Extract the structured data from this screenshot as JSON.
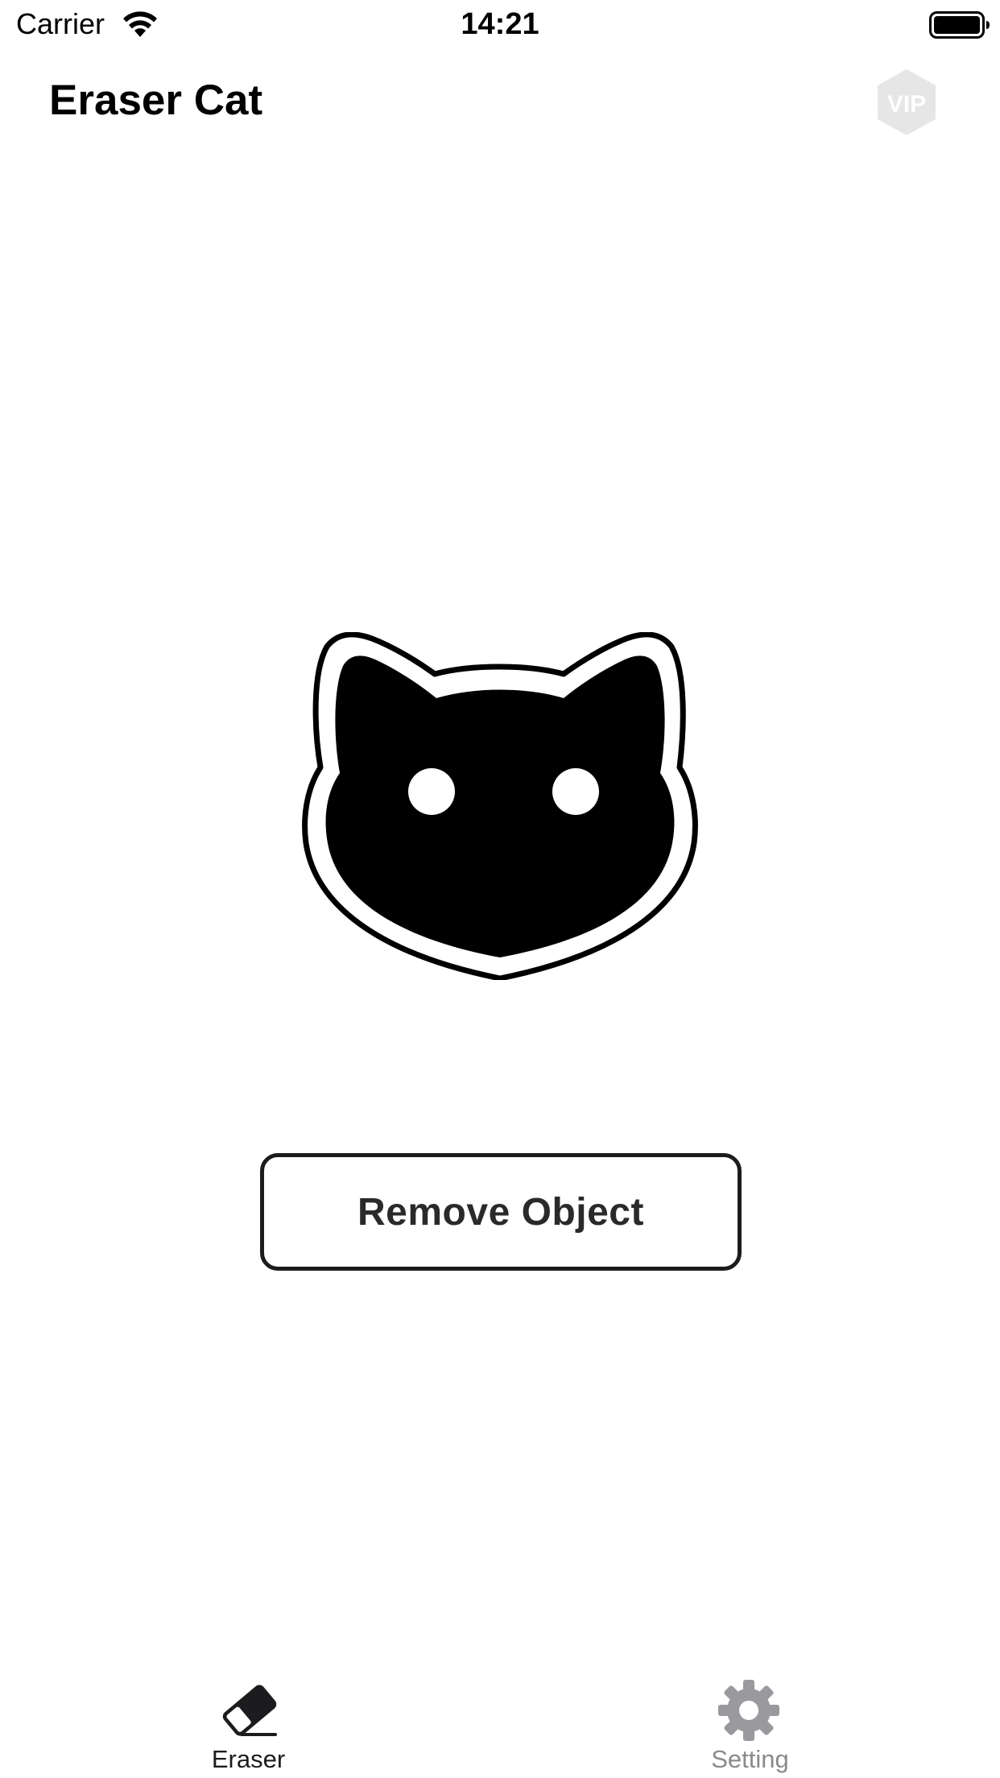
{
  "status_bar": {
    "carrier": "Carrier",
    "time": "14:21",
    "wifi_icon": "wifi-icon",
    "battery_icon": "battery-full-icon"
  },
  "header": {
    "title": "Eraser Cat",
    "vip_badge_text": "VIP",
    "vip_icon": "vip-hexagon-icon"
  },
  "main": {
    "logo_icon": "cat-face-logo-icon",
    "remove_button_label": "Remove Object"
  },
  "tab_bar": {
    "tabs": [
      {
        "label": "Eraser",
        "icon": "eraser-icon",
        "selected": true
      },
      {
        "label": "Setting",
        "icon": "gear-icon",
        "selected": false
      }
    ]
  },
  "colors": {
    "background": "#ffffff",
    "text_primary": "#000000",
    "button_border": "#1c1c1e",
    "tab_active": "#1c1c1e",
    "tab_inactive": "#8a8a8e",
    "vip_badge": "#e6e6e6"
  }
}
